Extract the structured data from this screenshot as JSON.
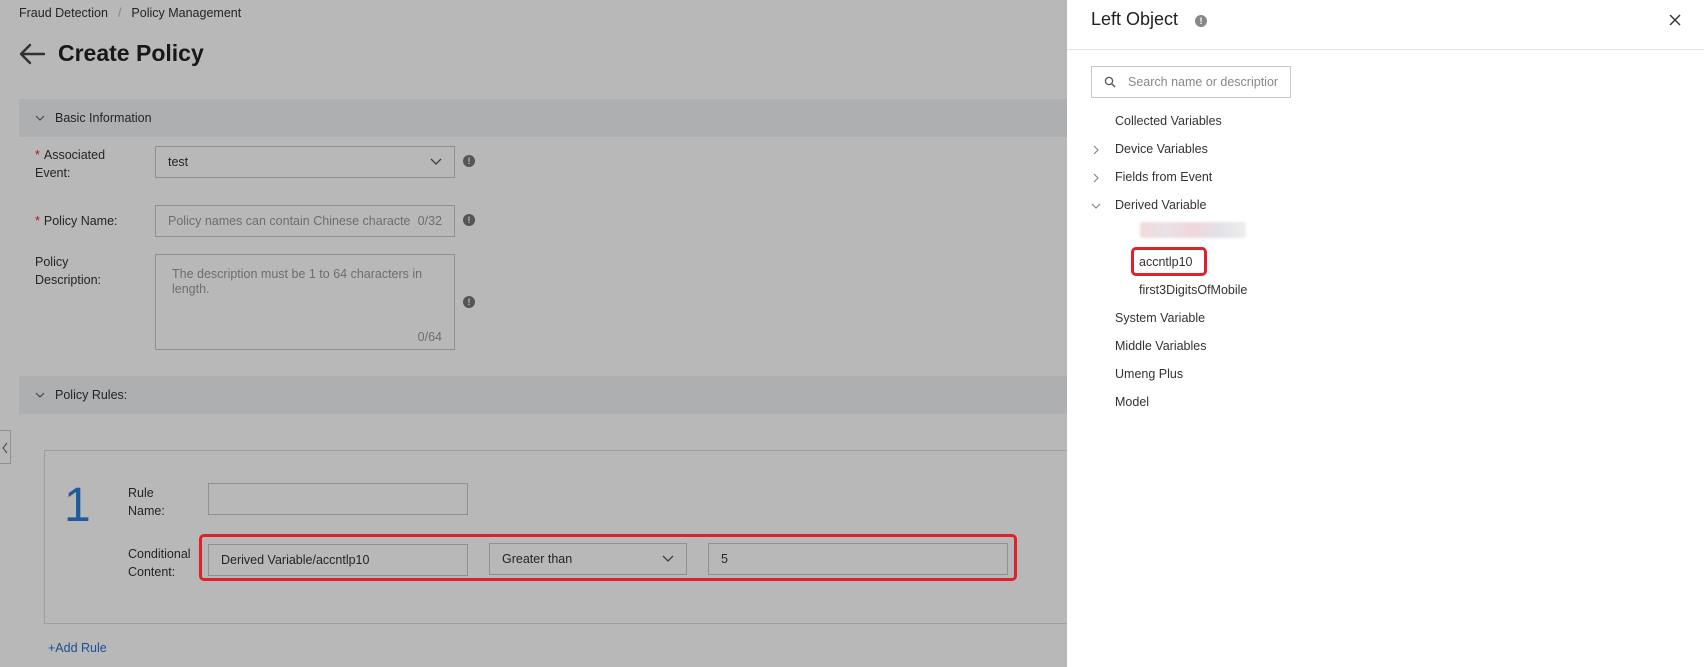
{
  "breadcrumb": {
    "items": [
      "Fraud Detection",
      "Policy Management"
    ],
    "separator": "/"
  },
  "page": {
    "title": "Create Policy"
  },
  "basic_info": {
    "section_title": "Basic Information",
    "associated_event": {
      "label": "Associated Event:",
      "value": "test"
    },
    "policy_name": {
      "label": "Policy Name:",
      "placeholder": "Policy names can contain Chinese characters",
      "count": "0/32"
    },
    "policy_description": {
      "label": "Policy Description:",
      "placeholder": "The description must be 1 to 64 characters in length.",
      "count": "0/64"
    }
  },
  "policy_rules": {
    "section_title": "Policy Rules:",
    "rule": {
      "number": "1",
      "name_label": "Rule Name:",
      "name_value": "",
      "condition_label": "Conditional Content:",
      "left_object": "Derived Variable/accntlp10",
      "operator": "Greater than",
      "right_value": "5"
    },
    "add_rule_label": "+Add Rule"
  },
  "drawer": {
    "title": "Left Object",
    "search_placeholder": "Search name or description",
    "tree": {
      "collected": "Collected Variables",
      "device": "Device Variables",
      "fields": "Fields from Event",
      "derived": "Derived Variable",
      "derived_children": [
        "accntlp10",
        "first3DigitsOfMobile"
      ],
      "system": "System Variable",
      "middle": "Middle Variables",
      "umeng": "Umeng Plus",
      "model": "Model"
    }
  },
  "colors": {
    "accent_blue": "#2a7dd8",
    "highlight_red": "#e0202c",
    "required_red": "#e0302c"
  }
}
